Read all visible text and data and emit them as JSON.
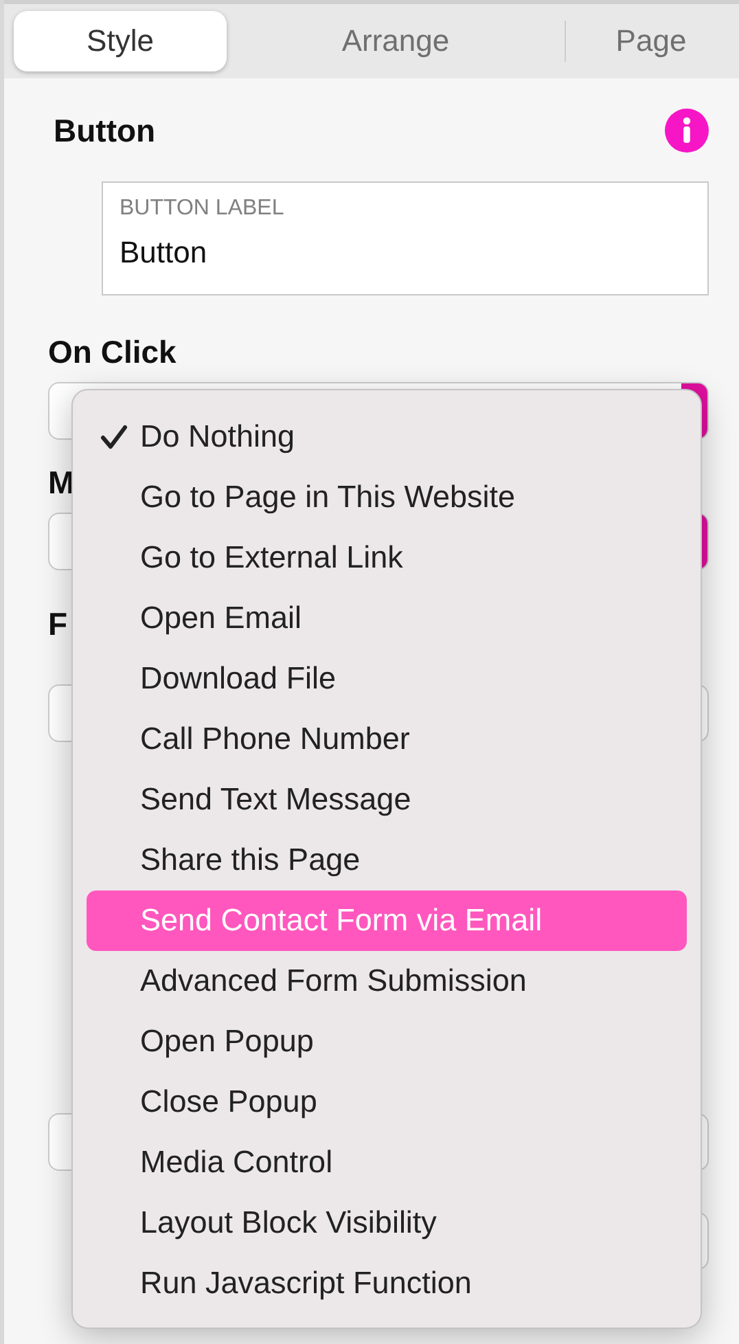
{
  "tabs": [
    {
      "label": "Style",
      "selected": true
    },
    {
      "label": "Arrange",
      "selected": false
    },
    {
      "label": "Page",
      "selected": false
    }
  ],
  "panel": {
    "title": "Button",
    "label_field": {
      "label": "BUTTON LABEL",
      "value": "Button"
    },
    "on_click_label": "On Click",
    "hidden_labels": [
      "M",
      "F"
    ]
  },
  "menu": {
    "items": [
      {
        "label": "Do Nothing",
        "checked": true,
        "selected": false
      },
      {
        "label": "Go to Page in This Website",
        "checked": false,
        "selected": false
      },
      {
        "label": "Go to External Link",
        "checked": false,
        "selected": false
      },
      {
        "label": "Open Email",
        "checked": false,
        "selected": false
      },
      {
        "label": "Download File",
        "checked": false,
        "selected": false
      },
      {
        "label": "Call Phone Number",
        "checked": false,
        "selected": false
      },
      {
        "label": "Send Text Message",
        "checked": false,
        "selected": false
      },
      {
        "label": "Share this Page",
        "checked": false,
        "selected": false
      },
      {
        "label": "Send Contact Form via Email",
        "checked": false,
        "selected": true
      },
      {
        "label": "Advanced Form Submission",
        "checked": false,
        "selected": false
      },
      {
        "label": "Open Popup",
        "checked": false,
        "selected": false
      },
      {
        "label": "Close Popup",
        "checked": false,
        "selected": false
      },
      {
        "label": "Media Control",
        "checked": false,
        "selected": false
      },
      {
        "label": "Layout Block Visibility",
        "checked": false,
        "selected": false
      },
      {
        "label": "Run Javascript Function",
        "checked": false,
        "selected": false
      }
    ]
  }
}
